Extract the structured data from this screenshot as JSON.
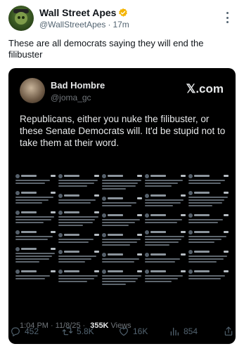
{
  "post": {
    "author_name": "Wall Street Apes",
    "handle": "@WallStreetApes",
    "separator": "·",
    "time_ago": "17m",
    "text": "These are all democrats saying they will end the filibuster"
  },
  "embedded": {
    "name": "Bad Hombre",
    "handle": "@joma_gc",
    "brand": "𝕏.com",
    "body": "Republicans, either you nuke the filibuster, or these Senate Democrats will. It'd be stupid not to take them at their word.",
    "time": "1:04 PM",
    "date": "11/8/25",
    "separator": "·",
    "views": "355K",
    "views_label": "Views"
  },
  "actions": {
    "replies": "452",
    "reposts": "5.8K",
    "likes": "16K",
    "views": "854"
  },
  "colors": {
    "verified": "#f4b400",
    "card_bg": "#000000",
    "muted": "#536471"
  },
  "icons": [
    "verified-badge-icon",
    "more-options-icon",
    "reply-icon",
    "retweet-icon",
    "like-icon",
    "views-icon",
    "share-icon"
  ]
}
